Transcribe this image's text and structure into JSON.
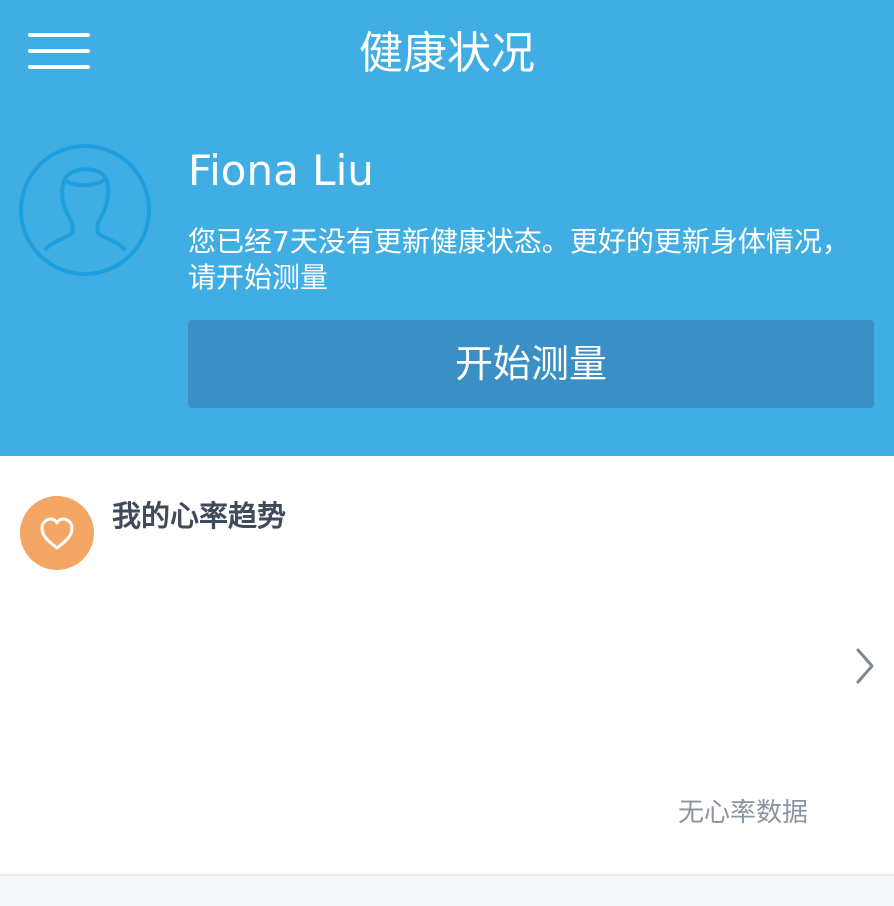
{
  "header": {
    "title": "健康状况",
    "menu_icon": "hamburger-menu-icon"
  },
  "profile": {
    "avatar_icon": "user-avatar-icon",
    "name": "Fiona Liu",
    "notice": "您已经7天没有更新健康状态。更好的更新身体情况，请开始测量",
    "measure_button": "开始测量"
  },
  "heart_trend": {
    "icon": "heart-icon",
    "title": "我的心率趋势",
    "chevron_icon": "chevron-right-icon",
    "empty_text": "无心率数据"
  },
  "colors": {
    "header_bg": "#41aee3",
    "button_bg": "#3a8fc5",
    "avatar_stroke": "#1e9fe0",
    "heart_badge": "#f4a664"
  }
}
